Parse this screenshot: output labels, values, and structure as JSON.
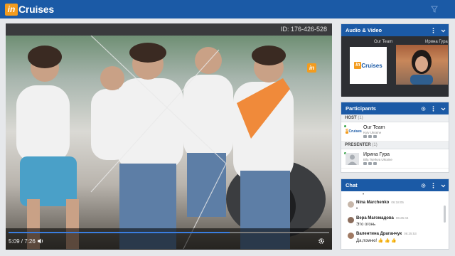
{
  "header": {
    "logo_in": "in",
    "logo_text": "Cruises"
  },
  "video": {
    "id_label": "ID: 176-426-528",
    "badge": "in",
    "time": "5:09 / 7:26",
    "progress": 0.69
  },
  "av_panel": {
    "title": "Audio & Video",
    "tile1_label": "Our Team",
    "tile2_label": "Ирина Гура",
    "mini_logo_in": "in",
    "mini_logo_text": "Cruises"
  },
  "participants": {
    "title": "Participants",
    "host_label": "HOST",
    "host_count": "(1)",
    "host_name": "Our Team",
    "host_location": "Kyiv Ukraine",
    "presenter_label": "PRESENTER",
    "presenter_count": "(1)",
    "presenter_name": "Ирина Гура",
    "presenter_location": "Bila Tserkva Ukraine"
  },
  "chat": {
    "title": "Chat",
    "messages": [
      {
        "name": "Nina Marchenko",
        "time": "06:18:05",
        "text": "•"
      },
      {
        "name": "Вера Магомадова",
        "time": "06:25:44",
        "text": "Это огонь"
      },
      {
        "name": "Валентина Драганчук",
        "time": "06:25:53",
        "text": "Да,помню! 👍 👍 👍"
      }
    ]
  },
  "colors": {
    "brand_blue": "#1b5aa6",
    "brand_orange": "#f39c1f",
    "progress_blue": "#3a7de0"
  }
}
